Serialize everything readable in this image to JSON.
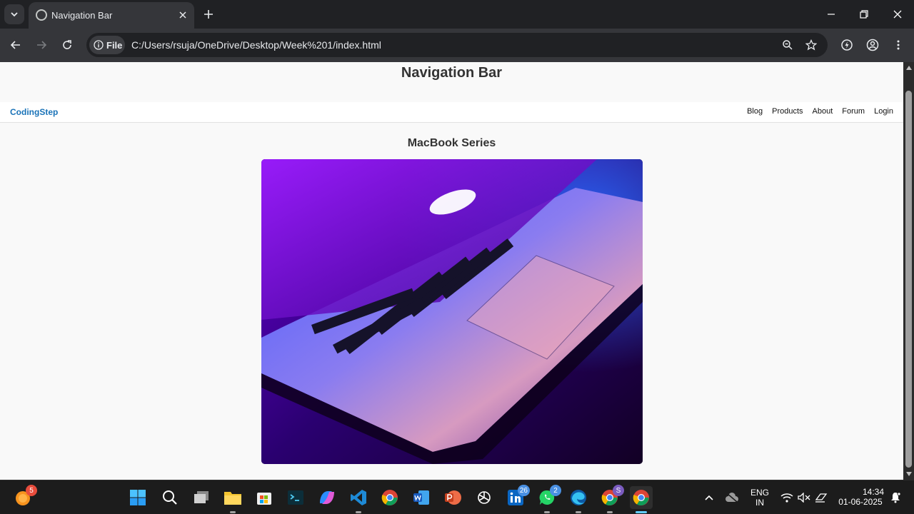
{
  "browser": {
    "tab_title": "Navigation Bar",
    "chip_label": "File",
    "url": "C:/Users/rsuja/OneDrive/Desktop/Week%201/index.html"
  },
  "page": {
    "heading": "Navigation Bar",
    "brand": "CodingStep",
    "nav_links": [
      "Blog",
      "Products",
      "About",
      "Forum",
      "Login"
    ],
    "section_title": "MacBook Series",
    "image_alt": "MacBook laptop with purple and blue lighting"
  },
  "taskbar": {
    "notification_badge": "5",
    "linkedin_badge": "26",
    "whatsapp_badge": "2",
    "chrome_profile_badge": "S",
    "language": "ENG",
    "region": "IN",
    "time": "14:34",
    "date": "01-06-2025"
  },
  "colors": {
    "brand": "#1a73b8",
    "page_bg": "#f9f9f9",
    "chrome_dark": "#202124",
    "chrome_toolbar": "#35363a"
  }
}
